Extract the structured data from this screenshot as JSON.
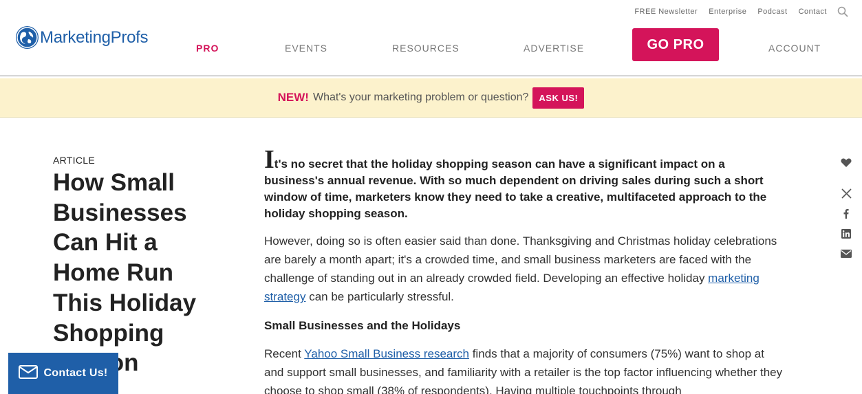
{
  "header": {
    "logo_text": "MarketingProfs",
    "utility_links": [
      "FREE Newsletter",
      "Enterprise",
      "Podcast",
      "Contact"
    ],
    "nav": {
      "pro": "PRO",
      "events": "EVENTS",
      "resources": "RESOURCES",
      "advertise": "ADVERTISE",
      "go_pro": "GO PRO",
      "account": "ACCOUNT"
    },
    "accent_color": "#d4145a",
    "brand_color": "#1f5fa8"
  },
  "banner": {
    "new_label": "NEW!",
    "question": "What's your marketing problem or question?",
    "ask_button": "ASK US!"
  },
  "article": {
    "kicker": "ARTICLE",
    "title": "How Small Businesses Can Hit a Home Run This Holiday Shopping Season",
    "lede_dropcap": "I",
    "lede_rest": "t's no secret that the holiday shopping season can have a significant impact on a business's annual revenue. With so much dependent on driving sales during such a short window of time, marketers know they need to take a creative, multifaceted approach to the holiday shopping season.",
    "p1_before": "However, doing so is often easier said than done. Thanksgiving and Christmas holiday celebrations are barely a month apart; it's a crowded time, and small business marketers are faced with the challenge of standing out in an already crowded field. Developing an effective holiday ",
    "p1_link": "marketing strategy",
    "p1_after": " can be particularly stressful.",
    "subhead": "Small Businesses and the Holidays",
    "p2_before": "Recent ",
    "p2_link": "Yahoo Small Business research",
    "p2_after": " finds that a majority of consumers (75%) want to shop at and support small businesses, and familiarity with a retailer is the top factor influencing whether they choose to shop small (38% of respondents). Having multiple touchpoints through"
  },
  "share": [
    "heart-icon",
    "x-icon",
    "facebook-icon",
    "linkedin-icon",
    "email-icon"
  ],
  "contact": {
    "label": "Contact Us!"
  }
}
